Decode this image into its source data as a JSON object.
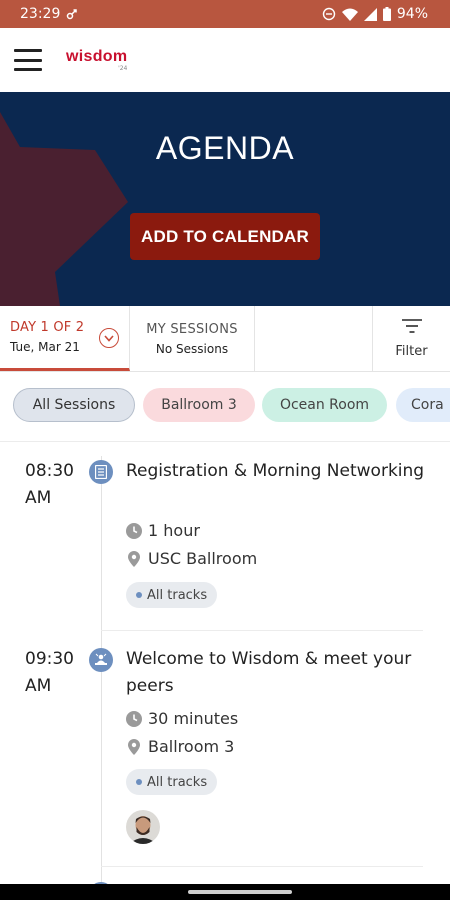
{
  "status_bar": {
    "time": "23:29",
    "battery": "94%"
  },
  "app": {
    "logo_text": "wisdom",
    "logo_sub": "'24"
  },
  "hero": {
    "title": "AGENDA",
    "calendar_button": "ADD TO CALENDAR"
  },
  "tabs": {
    "day": {
      "label": "DAY 1 OF 2",
      "date": "Tue, Mar 21"
    },
    "my_sessions": {
      "label": "MY SESSIONS",
      "status": "No Sessions"
    },
    "filter": {
      "label": "Filter"
    }
  },
  "chips": [
    {
      "label": "All Sessions"
    },
    {
      "label": "Ballroom 3"
    },
    {
      "label": "Ocean Room"
    },
    {
      "label": "Cora"
    }
  ],
  "sessions": [
    {
      "time_hm": "08:30",
      "time_ampm": "AM",
      "title": "Registration & Morning Networking",
      "duration": "1 hour",
      "location": "USC Ballroom",
      "track": "All tracks",
      "icon": "registration-icon"
    },
    {
      "time_hm": "09:30",
      "time_ampm": "AM",
      "title": "Welcome to Wisdom & meet your peers",
      "duration": "30 minutes",
      "location": "Ballroom 3",
      "track": "All tracks",
      "icon": "presenter-icon"
    }
  ],
  "colors": {
    "status_bar": "#b8563f",
    "hero_bg": "#0b2850",
    "cta": "#8b1a0e",
    "accent": "#c84b3a",
    "session_icon": "#6d8fbf"
  }
}
